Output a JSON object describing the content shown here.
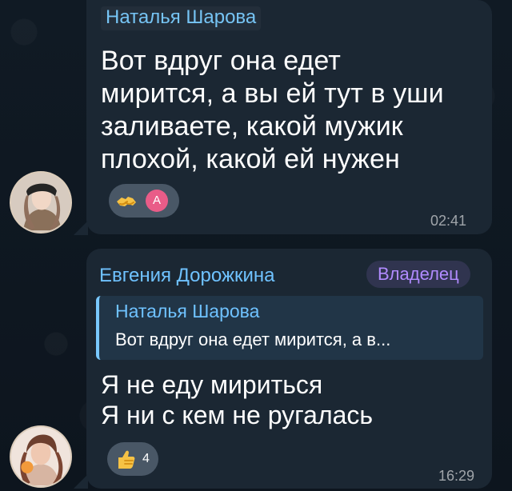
{
  "messages": [
    {
      "sender": "Наталья Шарова",
      "text_lines": [
        "Вот вдруг она едет",
        "мирится, а вы ей тут в уши",
        "заливаете, какой мужик",
        "плохой, какой ей нужен"
      ],
      "reaction": {
        "emoji": "handshake-icon",
        "reactor_initial": "A"
      },
      "time": "02:41"
    },
    {
      "sender": "Евгения Дорожкина",
      "badge": "Владелец",
      "reply": {
        "sender": "Наталья Шарова",
        "text": "Вот вдруг она едет мирится, а в..."
      },
      "text_lines": [
        "Я не еду мириться",
        "Я ни с кем не ругалась"
      ],
      "reaction": {
        "emoji": "thumbs-up-icon",
        "count": "4"
      },
      "time": "16:29"
    }
  ],
  "colors": {
    "background": "#0e1620",
    "bubble": "#1b2733",
    "name_blue": "#6fc2ff",
    "owner_purple": "#b18bff",
    "reaction_bg": "#495766",
    "reactor_avatar": "#e95c88"
  }
}
